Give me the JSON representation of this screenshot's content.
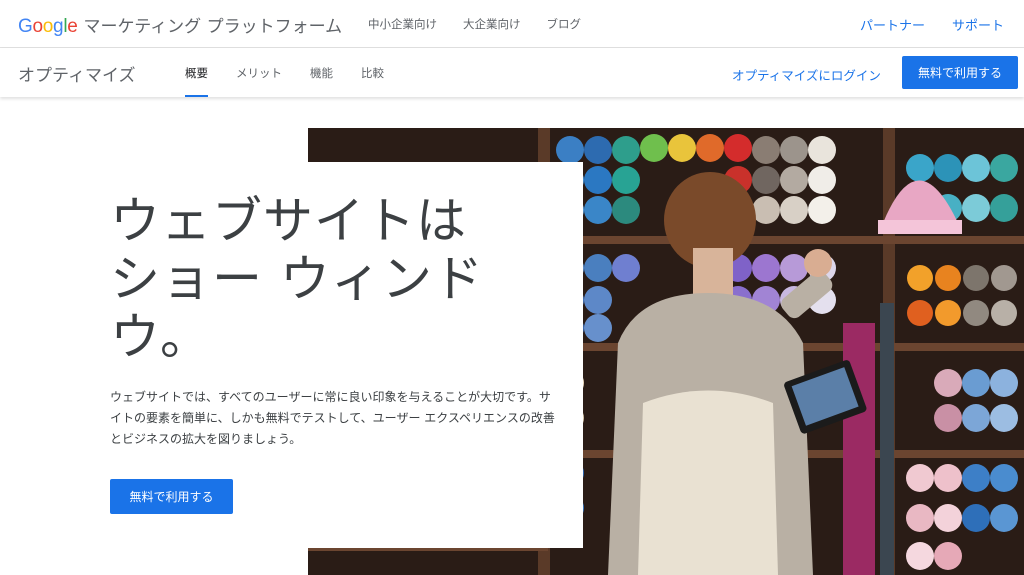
{
  "header": {
    "logo_letters": [
      "G",
      "o",
      "o",
      "g",
      "l",
      "e"
    ],
    "product_suite": "マーケティング プラットフォーム",
    "links": [
      "中小企業向け",
      "大企業向け",
      "ブログ"
    ],
    "right_links": [
      "パートナー",
      "サポート"
    ]
  },
  "subnav": {
    "product": "オプティマイズ",
    "tabs": [
      "概要",
      "メリット",
      "機能",
      "比較"
    ],
    "active_tab": "概要",
    "login": "オプティマイズにログイン",
    "cta": "無料で利用する"
  },
  "hero": {
    "headline_lines": [
      "ウェブサイトは",
      "ショー ウィンド",
      "ウ。"
    ],
    "description": "ウェブサイトでは、すべてのユーザーに常に良い印象を与えることが大切です。サイトの要素を簡単に、しかも無料でテストして、ユーザー エクスペリエンスの改善とビジネスの拡大を図りましょう。",
    "cta": "無料で利用する",
    "image_alt": "yarn-shop-photo"
  },
  "colors": {
    "accent": "#1a73e8",
    "text": "#3c4043"
  }
}
